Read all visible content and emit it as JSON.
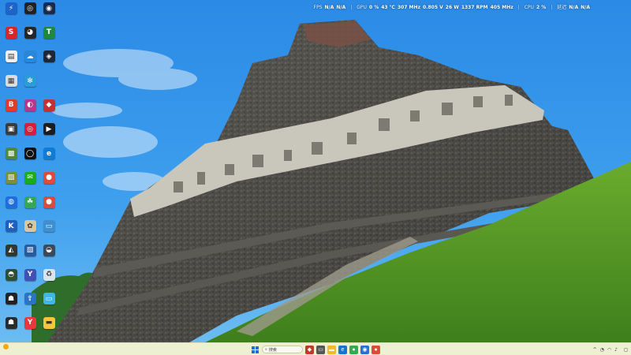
{
  "overlay": {
    "fps": {
      "label": "FPS",
      "values": [
        "N/A",
        "N/A"
      ]
    },
    "gpu": {
      "label": "GPU",
      "util": "0 %",
      "temp": "43 ℃",
      "clock": "307 MHz",
      "volt": "0.805 V",
      "power": "26 W",
      "fan": "1337 RPM",
      "mem": "405 MHz"
    },
    "cpu": {
      "label": "CPU",
      "util": "2 %"
    },
    "latency": {
      "label": "延迟",
      "values": [
        "N/A",
        "N/A"
      ]
    }
  },
  "desktop_icons": [
    {
      "name": "app-1",
      "label": "",
      "glyph": "⚡",
      "color": "#1c64c8"
    },
    {
      "name": "app-2",
      "label": "",
      "glyph": "◎",
      "color": "#222222"
    },
    {
      "name": "app-3",
      "label": "",
      "glyph": "◉",
      "color": "#1a2a4a"
    },
    {
      "name": "app-4",
      "label": "",
      "glyph": "S",
      "color": "#d7262b"
    },
    {
      "name": "app-5",
      "label": "",
      "glyph": "◕",
      "color": "#262626"
    },
    {
      "name": "app-6",
      "label": "",
      "glyph": "T",
      "color": "#1e8a3e"
    },
    {
      "name": "app-7",
      "label": "",
      "glyph": "▤",
      "color": "#f0f0f0"
    },
    {
      "name": "app-8",
      "label": "",
      "glyph": "☁",
      "color": "#2a86d6"
    },
    {
      "name": "app-9",
      "label": "",
      "glyph": "◈",
      "color": "#1b2838"
    },
    {
      "name": "app-10",
      "label": "",
      "glyph": "▦",
      "color": "#dcdcdc"
    },
    {
      "name": "app-11",
      "label": "",
      "glyph": "✻",
      "color": "#2b9bd9"
    },
    {
      "name": "app-12",
      "label": "",
      "glyph": "",
      "color": ""
    },
    {
      "name": "app-13",
      "label": "",
      "glyph": "B",
      "color": "#e4392b"
    },
    {
      "name": "app-14",
      "label": "",
      "glyph": "◐",
      "color": "#b23a8e"
    },
    {
      "name": "app-15",
      "label": "",
      "glyph": "◆",
      "color": "#c53030"
    },
    {
      "name": "app-16",
      "label": "",
      "glyph": "▣",
      "color": "#3b3b3b"
    },
    {
      "name": "app-17",
      "label": "",
      "glyph": "◎",
      "color": "#d41f3a"
    },
    {
      "name": "app-18",
      "label": "",
      "glyph": "▶",
      "color": "#1d1d1d"
    },
    {
      "name": "app-19",
      "label": "",
      "glyph": "▩",
      "color": "#4e8a3a"
    },
    {
      "name": "app-20",
      "label": "",
      "glyph": "◯",
      "color": "#111111"
    },
    {
      "name": "app-21",
      "label": "",
      "glyph": "e",
      "color": "#0f7dd7"
    },
    {
      "name": "app-22",
      "label": "",
      "glyph": "▨",
      "color": "#7b8f3a"
    },
    {
      "name": "app-23",
      "label": "",
      "glyph": "✉",
      "color": "#1aad19"
    },
    {
      "name": "app-24",
      "label": "",
      "glyph": "●",
      "color": "#dd4b39"
    },
    {
      "name": "app-25",
      "label": "",
      "glyph": "◍",
      "color": "#1d6fe0"
    },
    {
      "name": "app-26",
      "label": "",
      "glyph": "☘",
      "color": "#35a853"
    },
    {
      "name": "app-27",
      "label": "",
      "glyph": "●",
      "color": "#dd4b39"
    },
    {
      "name": "app-28",
      "label": "",
      "glyph": "K",
      "color": "#1f5fbf"
    },
    {
      "name": "app-29",
      "label": "",
      "glyph": "✿",
      "color": "#d9c7a0"
    },
    {
      "name": "app-30",
      "label": "",
      "glyph": "▭",
      "color": "#3c8fd0"
    },
    {
      "name": "app-31",
      "label": "",
      "glyph": "◭",
      "color": "#2e3a2e"
    },
    {
      "name": "app-32",
      "label": "",
      "glyph": "▧",
      "color": "#2a5a9a"
    },
    {
      "name": "app-33",
      "label": "",
      "glyph": "◒",
      "color": "#3a4a5a"
    },
    {
      "name": "app-34",
      "label": "",
      "glyph": "◓",
      "color": "#2c5030"
    },
    {
      "name": "app-35",
      "label": "",
      "glyph": "Y",
      "color": "#3f51b5"
    },
    {
      "name": "app-36",
      "label": "",
      "glyph": "♻",
      "color": "#d8e4f0"
    },
    {
      "name": "app-37",
      "label": "",
      "glyph": "☗",
      "color": "#222222"
    },
    {
      "name": "app-38",
      "label": "",
      "glyph": "⇪",
      "color": "#2a74c8"
    },
    {
      "name": "app-39",
      "label": "",
      "glyph": "▭",
      "color": "#3fb5e8"
    },
    {
      "name": "app-40",
      "label": "",
      "glyph": "☗",
      "color": "#2b2b2b"
    },
    {
      "name": "app-41",
      "label": "",
      "glyph": "Y",
      "color": "#e8383d"
    },
    {
      "name": "app-42",
      "label": "",
      "glyph": "▬",
      "color": "#f5c542"
    }
  ],
  "taskbar": {
    "weather_temp": "",
    "weather_desc": "",
    "search_placeholder": "搜索",
    "pinned": [
      {
        "name": "widgets",
        "glyph": "◆",
        "color": "#c0392b"
      },
      {
        "name": "task-view",
        "glyph": "▭",
        "color": "#555555"
      },
      {
        "name": "file-explorer",
        "glyph": "▬",
        "color": "#f2b72a"
      },
      {
        "name": "edge",
        "glyph": "e",
        "color": "#1574d0"
      },
      {
        "name": "browser-a",
        "glyph": "●",
        "color": "#35a853"
      },
      {
        "name": "browser-b",
        "glyph": "◉",
        "color": "#2a6fd6"
      },
      {
        "name": "chrome",
        "glyph": "●",
        "color": "#dd4b39"
      }
    ],
    "time": "",
    "date": ""
  }
}
